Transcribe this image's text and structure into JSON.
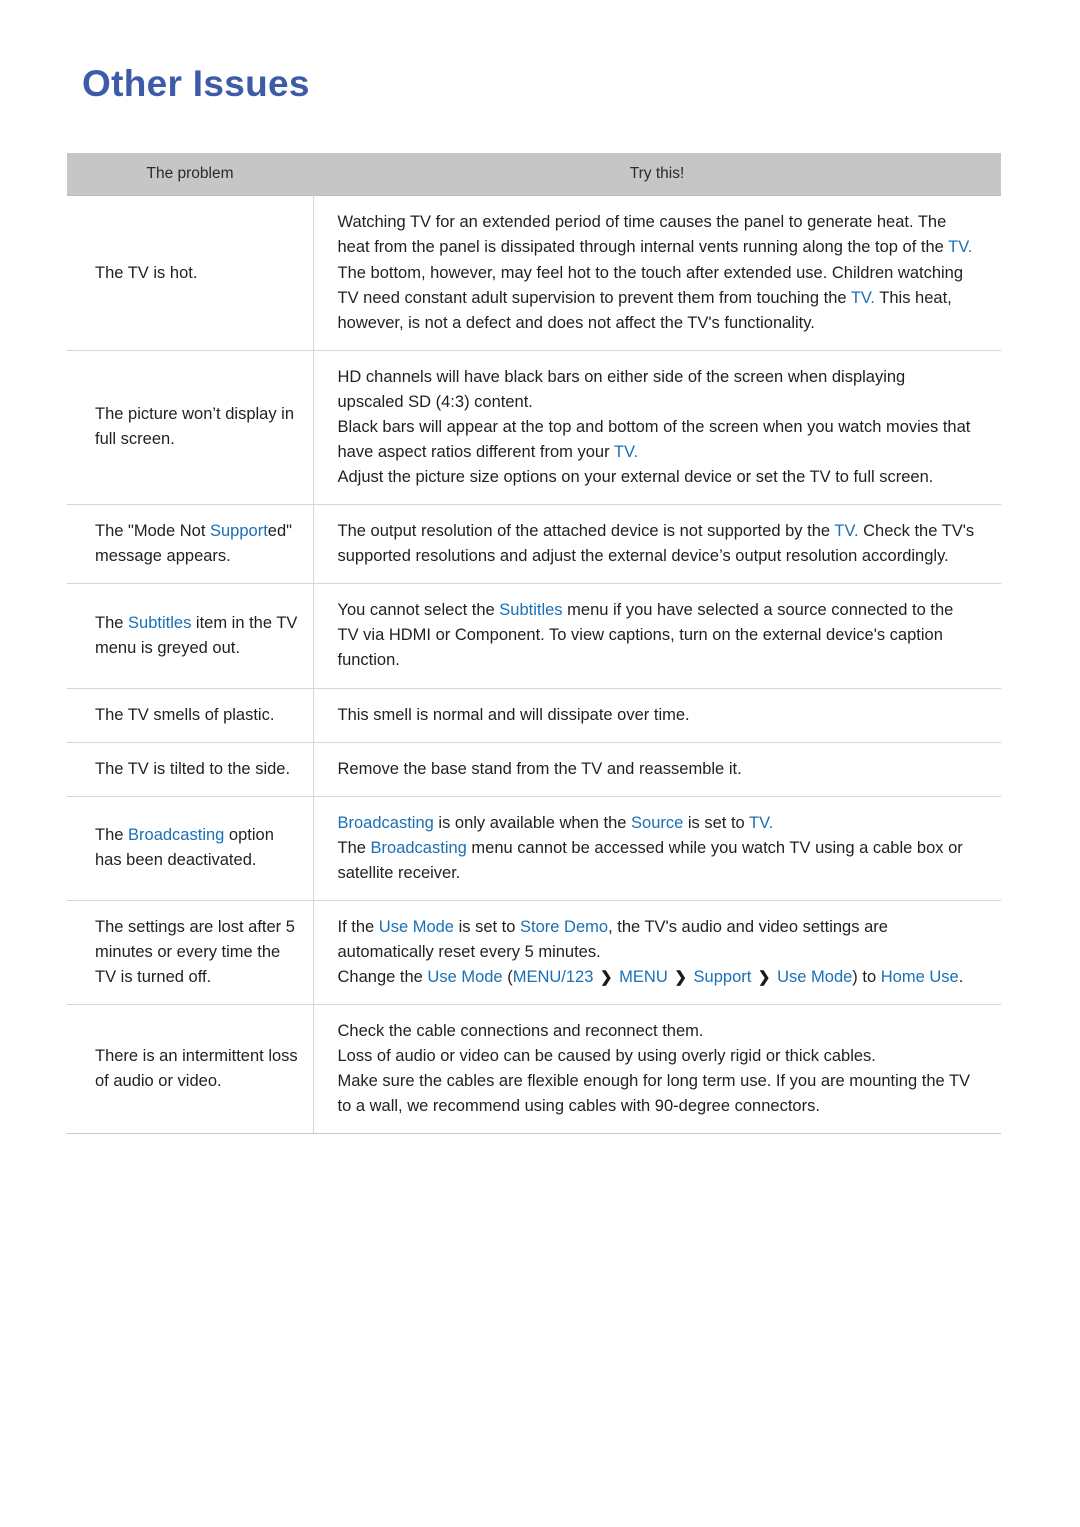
{
  "page": {
    "title": "Other Issues"
  },
  "table": {
    "headers": {
      "problem": "The problem",
      "solution": "Try this!"
    },
    "rows": [
      {
        "problem": "The TV is hot.",
        "solution_lines": [
          "Watching TV for an extended period of time causes the panel to generate heat. The heat from the panel is dissipated through internal vents running along the top of the TV. The bottom, however, may feel hot to the touch after extended use. Children watching TV need constant adult supervision to prevent them from touching the TV. This heat, however, is not a defect and does not affect the TV's functionality."
        ]
      },
      {
        "problem": "The picture won’t display in full screen.",
        "solution_lines": [
          "HD channels will have black bars on either side of the screen when displaying upscaled SD (4:3) content.",
          "Black bars will appear at the top and bottom of the screen when you watch movies that have aspect ratios different from your TV.",
          "Adjust the picture size options on your external device or set the TV to full screen."
        ]
      },
      {
        "problem": "The \"Mode Not Supported\" message appears.",
        "solution_lines": [
          "The output resolution of the attached device is not supported by the TV. Check the TV's supported resolutions and adjust the external device’s output resolution accordingly."
        ]
      },
      {
        "problem": "The Subtitles item in the TV menu is greyed out.",
        "solution_lines": [
          "You cannot select the Subtitles menu if you have selected a source connected to the TV via HDMI or Component. To view captions, turn on the external device's caption function."
        ]
      },
      {
        "problem": "The TV smells of plastic.",
        "solution_lines": [
          "This smell is normal and will dissipate over time."
        ]
      },
      {
        "problem": "The TV is tilted to the side.",
        "solution_lines": [
          "Remove the base stand from the TV and reassemble it."
        ]
      },
      {
        "problem": "The Broadcasting option has been deactivated.",
        "solution_lines": [
          "Broadcasting is only available when the Source is set to TV.",
          "The Broadcasting menu cannot be accessed while you watch TV using a cable box or satellite receiver."
        ]
      },
      {
        "problem": "The settings are lost after 5 minutes or every time the TV is turned off.",
        "solution_lines": [
          "If the Use Mode is set to Store Demo, the TV's audio and video settings are automatically reset every 5 minutes.",
          "Change the Use Mode (MENU/123 > MENU > Support > Use Mode) to Home Use."
        ]
      },
      {
        "problem": "There is an intermittent loss of audio or video.",
        "solution_lines": [
          "Check the cable connections and reconnect them.",
          "Loss of audio or video can be caused by using overly rigid or thick cables.",
          "Make sure the cables are flexible enough for long term use. If you are mounting the TV to a wall, we recommend using cables with 90-degree connectors."
        ]
      }
    ],
    "highlight_terms": [
      "Subtitles",
      "Broadcasting",
      "Source",
      "Use Mode",
      "Store Demo",
      "MENU/123",
      "MENU",
      "Support",
      "Home Use",
      "TV."
    ],
    "colors": {
      "title_blue": "#3d5ba8",
      "link_blue": "#1a6fb5",
      "header_bg": "#c6c6c6",
      "border": "#d6d6d6",
      "text": "#231f20"
    }
  }
}
